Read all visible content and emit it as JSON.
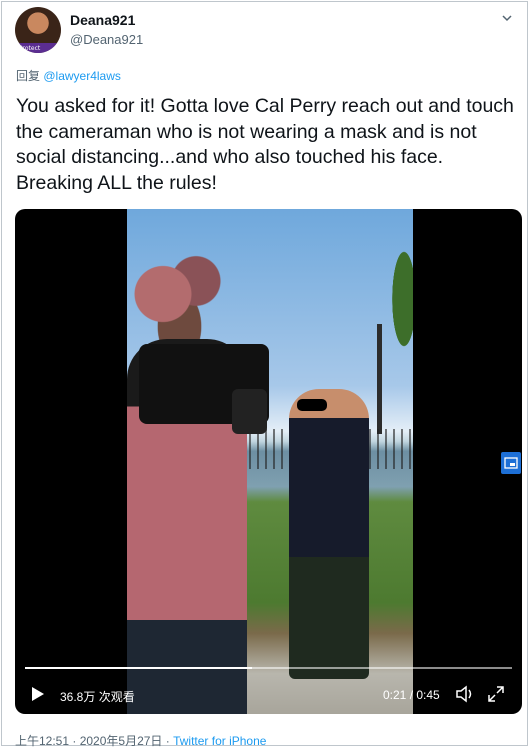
{
  "user": {
    "display_name": "Deana921",
    "handle": "@Deana921",
    "avatar_badge": "Protect"
  },
  "reply": {
    "prefix": "回复",
    "to": "@lawyer4laws"
  },
  "tweet": {
    "text": "You asked for it!  Gotta love Cal Perry reach out and touch the cameraman who is not wearing a mask and is not social distancing...and who also touched his face.  Breaking ALL the rules!"
  },
  "video": {
    "views": "36.8万 次观看",
    "time": "0:21 / 0:45",
    "progress": 0.467
  },
  "footer": {
    "timestamp": "上午12:51 · 2020年5月27日 · ",
    "source": "Twitter for iPhone"
  },
  "colors": {
    "link": "#1d9bf0",
    "muted": "#536471",
    "text": "#0f1419"
  }
}
